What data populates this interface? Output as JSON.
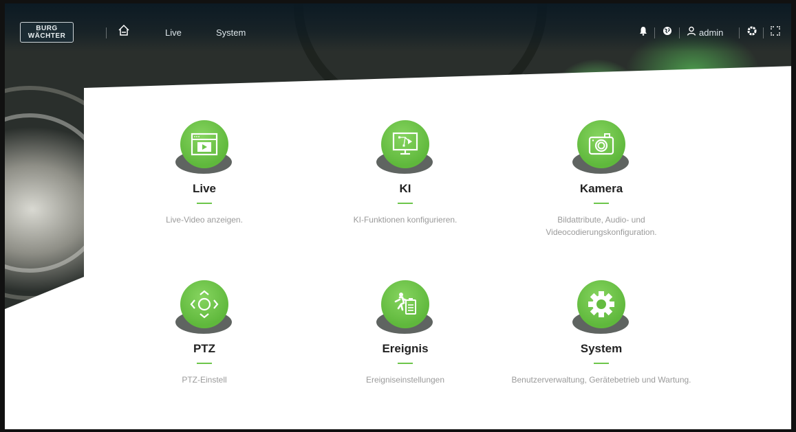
{
  "header": {
    "logo": {
      "line1": "BURG",
      "line2": "WÄCHTER"
    },
    "nav": [
      {
        "label": "Live"
      },
      {
        "label": "System"
      }
    ],
    "user": "admin"
  },
  "tiles": [
    {
      "title": "Live",
      "description": "Live-Video anzeigen.",
      "icon": "live-video-icon"
    },
    {
      "title": "KI",
      "description": "KI-Funktionen konfigurieren.",
      "icon": "ai-monitor-icon"
    },
    {
      "title": "Kamera",
      "description": "Bildattribute, Audio- und Videocodierungskonfiguration.",
      "icon": "camera-icon"
    },
    {
      "title": "PTZ",
      "description": "PTZ-Einstell",
      "icon": "ptz-icon"
    },
    {
      "title": "Ereignis",
      "description": "Ereigniseinstellungen",
      "icon": "event-icon"
    },
    {
      "title": "System",
      "description": "Benutzerverwaltung, Gerätebetrieb und Wartung.",
      "icon": "gear-icon"
    }
  ],
  "colors": {
    "accent": "#6cc64a",
    "header": "#10232d"
  }
}
